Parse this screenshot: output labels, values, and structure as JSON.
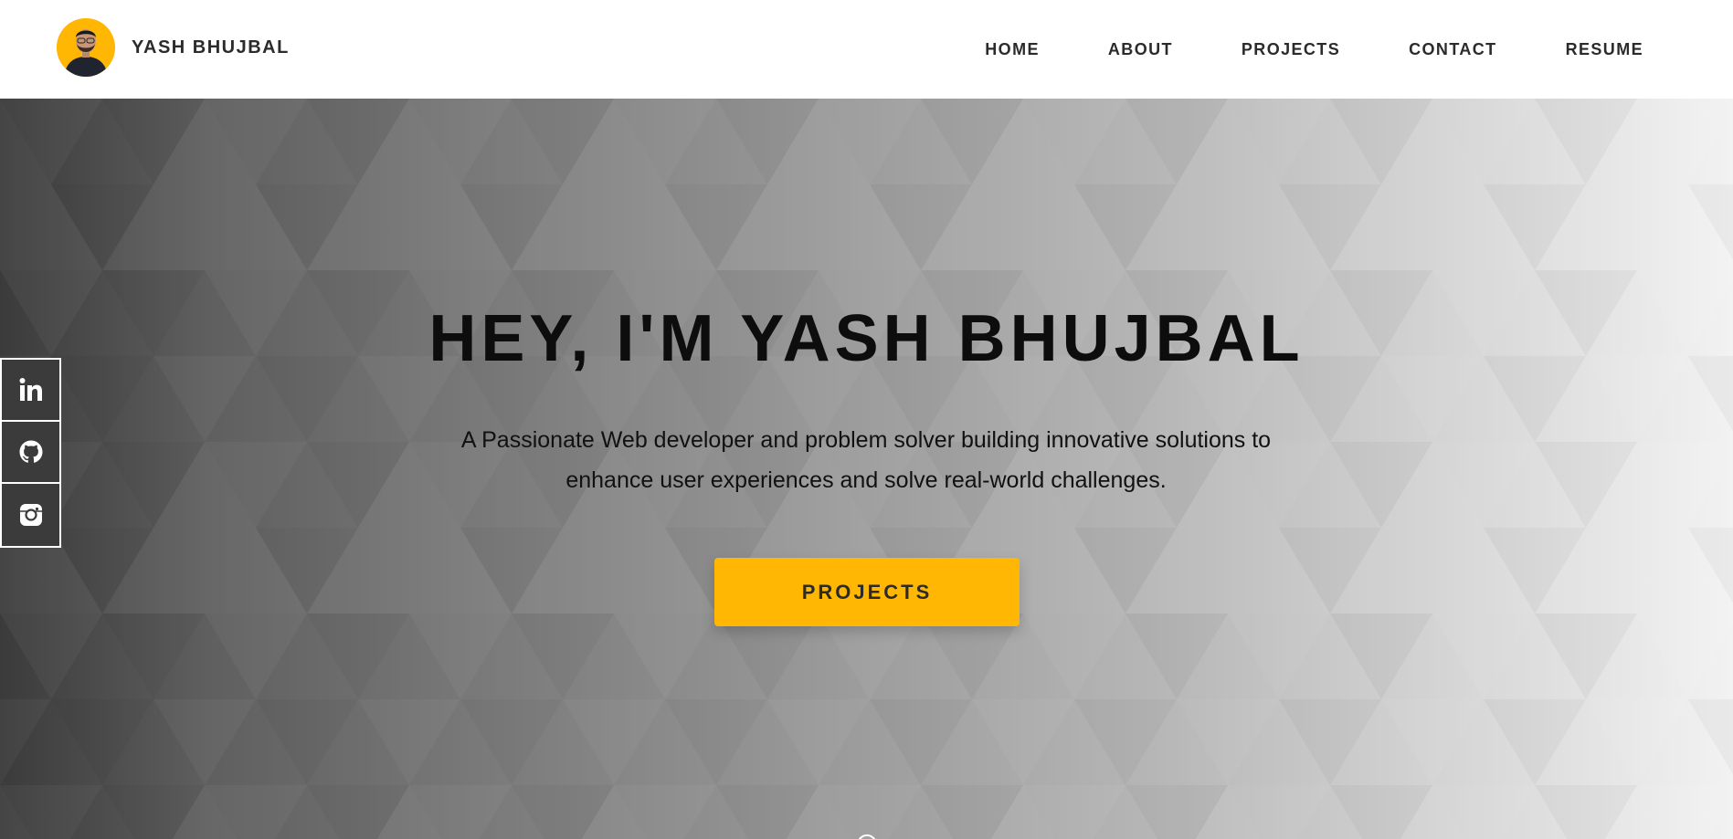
{
  "header": {
    "brand_name": "YASH BHUJBAL",
    "avatar_icon": "profile-photo",
    "nav": [
      {
        "label": "HOME"
      },
      {
        "label": "ABOUT"
      },
      {
        "label": "PROJECTS"
      },
      {
        "label": "CONTACT"
      },
      {
        "label": "RESUME"
      }
    ]
  },
  "hero": {
    "title": "HEY, I'M YASH BHUJBAL",
    "subtitle_line1": "A Passionate Web developer and problem solver building innovative solutions to",
    "subtitle_line2": "enhance user experiences and solve real-world challenges.",
    "cta_label": "PROJECTS"
  },
  "social": [
    {
      "icon": "linkedin-icon"
    },
    {
      "icon": "github-icon"
    },
    {
      "icon": "instagram-icon"
    }
  ],
  "colors": {
    "accent": "#ffb703",
    "text_dark": "#2b2b2b",
    "title": "#0d0d0d",
    "header_bg": "#ffffff"
  }
}
